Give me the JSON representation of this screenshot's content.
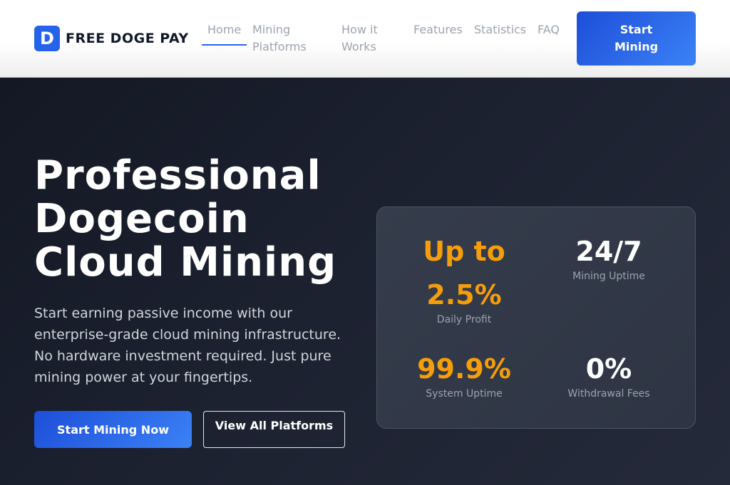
{
  "brand": {
    "logo_letter": "D",
    "name": "FREE DOGE PAY",
    "accent": "#2563eb"
  },
  "nav": {
    "items": [
      {
        "label": "Home",
        "active": true
      },
      {
        "label": "Mining Platforms",
        "active": false
      },
      {
        "label": "How it Works",
        "active": false
      },
      {
        "label": "Features",
        "active": false
      },
      {
        "label": "Statistics",
        "active": false
      },
      {
        "label": "FAQ",
        "active": false
      }
    ],
    "cta_label": "Start Mining"
  },
  "hero": {
    "title": "Professional Dogecoin Cloud Mining",
    "subtitle": "Start earning passive income with our enterprise-grade cloud mining infrastructure. No hardware investment required. Just pure mining power at your fingertips.",
    "primary_button": "Start Mining Now",
    "secondary_button": "View All Platforms"
  },
  "stats": [
    {
      "value": "Up to 2.5%",
      "label": "Daily Profit",
      "color": "#f59e0b"
    },
    {
      "value": "24/7",
      "label": "Mining Uptime",
      "color": "#ffffff"
    },
    {
      "value": "99.9%",
      "label": "System Uptime",
      "color": "#f59e0b"
    },
    {
      "value": "0%",
      "label": "Withdrawal Fees",
      "color": "#ffffff"
    }
  ]
}
